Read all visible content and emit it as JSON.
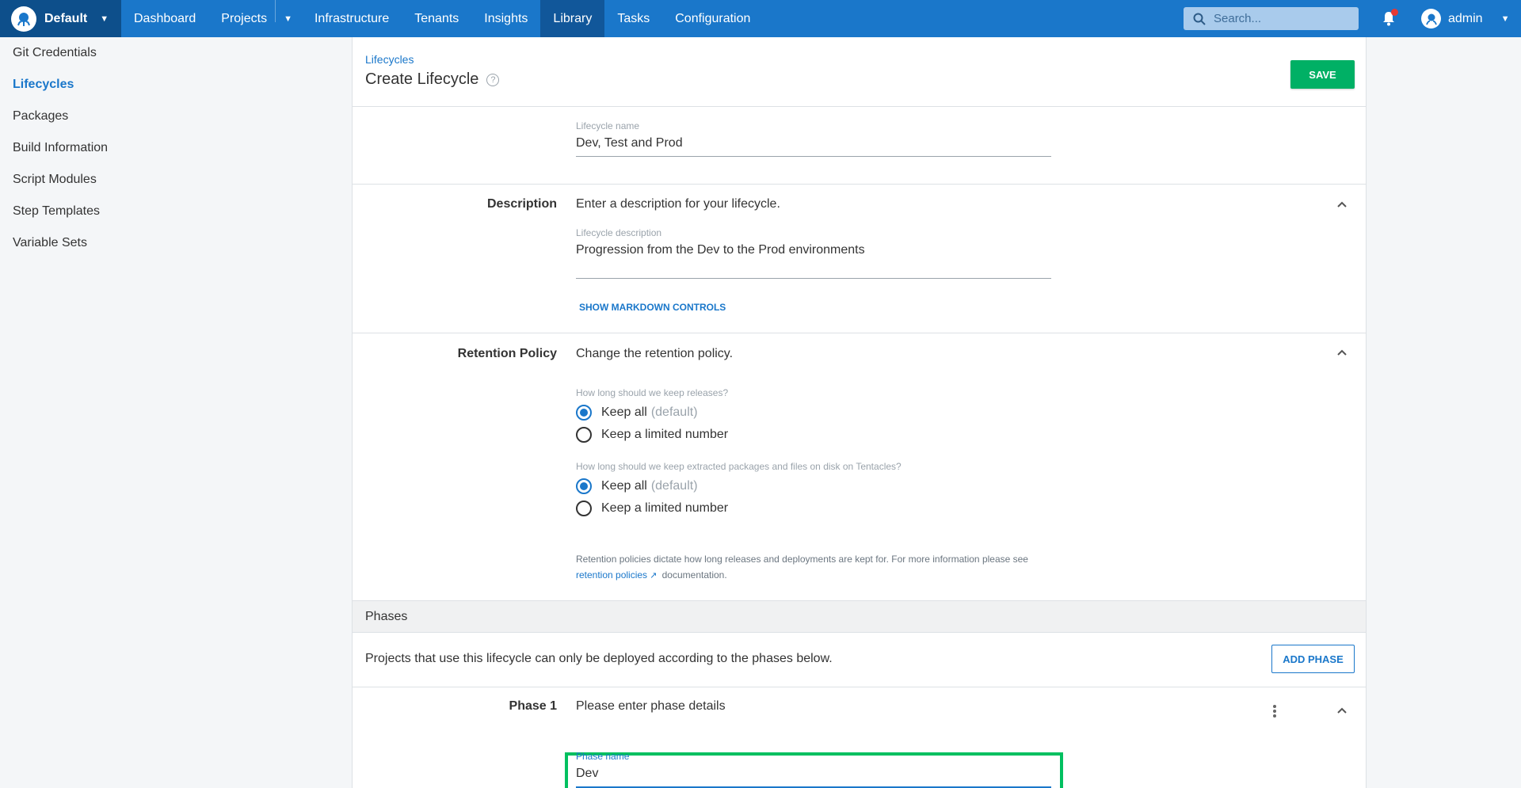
{
  "topbar": {
    "space": "Default",
    "nav": [
      "Dashboard",
      "Projects",
      "Infrastructure",
      "Tenants",
      "Insights",
      "Library",
      "Tasks",
      "Configuration"
    ],
    "active_nav": "Library",
    "search_placeholder": "Search...",
    "user": "admin"
  },
  "sidebar": {
    "items": [
      "Git Credentials",
      "Lifecycles",
      "Packages",
      "Build Information",
      "Script Modules",
      "Step Templates",
      "Variable Sets"
    ],
    "active": "Lifecycles"
  },
  "header": {
    "breadcrumb": "Lifecycles",
    "title": "Create Lifecycle",
    "save_label": "SAVE"
  },
  "name_section": {
    "label": "Lifecycle name",
    "value": "Dev, Test and Prod"
  },
  "description": {
    "heading": "Description",
    "summary": "Enter a description for your lifecycle.",
    "field_label": "Lifecycle description",
    "value": "Progression from the Dev to the Prod environments",
    "markdown_link": "SHOW MARKDOWN CONTROLS"
  },
  "retention": {
    "heading": "Retention Policy",
    "summary": "Change the retention policy.",
    "releases_question": "How long should we keep releases?",
    "files_question": "How long should we keep extracted packages and files on disk on Tentacles?",
    "keep_all": "Keep all",
    "default_tag": "(default)",
    "keep_limited": "Keep a limited number",
    "releases_selected": "keep_all",
    "files_selected": "keep_all",
    "note_prefix": "Retention policies dictate how long releases and deployments are kept for. For more information please see",
    "note_link": "retention policies",
    "note_suffix": "documentation."
  },
  "phases": {
    "heading": "Phases",
    "intro": "Projects that use this lifecycle can only be deployed according to the phases below.",
    "add_label": "ADD PHASE",
    "phase1": {
      "heading": "Phase 1",
      "summary": "Please enter phase details",
      "field_label": "Phase name",
      "value": "Dev"
    }
  },
  "colors": {
    "nav_bg": "#1a77ca",
    "accent": "#1a77ca",
    "save": "#00b065",
    "highlight": "#00c060"
  }
}
